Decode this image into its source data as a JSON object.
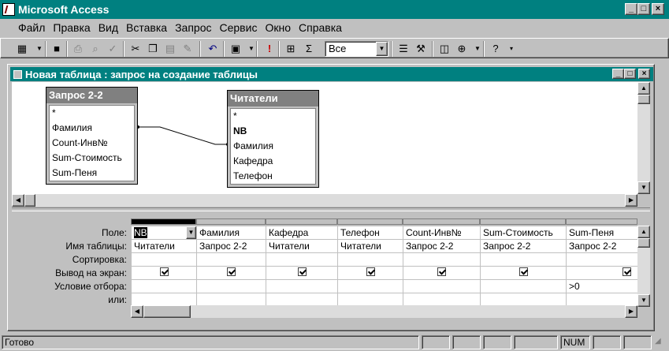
{
  "app": {
    "title": "Microsoft Access"
  },
  "menu": [
    "Файл",
    "Правка",
    "Вид",
    "Вставка",
    "Запрос",
    "Сервис",
    "Окно",
    "Справка"
  ],
  "toolbar": {
    "combo_value": "Все"
  },
  "child": {
    "title": "Новая таблица : запрос на создание таблицы"
  },
  "tables": [
    {
      "name": "Запрос 2-2",
      "fields": [
        "*",
        "Фамилия",
        "Count-Инв№",
        "Sum-Стоимость",
        "Sum-Пеня"
      ]
    },
    {
      "name": "Читатели",
      "fields": [
        "*",
        "NB",
        "Фамилия",
        "Кафедра",
        "Телефон"
      ]
    }
  ],
  "grid": {
    "row_labels": [
      "Поле:",
      "Имя таблицы:",
      "Сортировка:",
      "Вывод на экран:",
      "Условие отбора:",
      "или:"
    ],
    "columns": [
      {
        "field": "NB",
        "table": "Читатели",
        "criteria": ""
      },
      {
        "field": "Фамилия",
        "table": "Запрос 2-2",
        "criteria": ""
      },
      {
        "field": "Кафедра",
        "table": "Читатели",
        "criteria": ""
      },
      {
        "field": "Телефон",
        "table": "Читатели",
        "criteria": ""
      },
      {
        "field": "Count-Инв№",
        "table": "Запрос 2-2",
        "criteria": ""
      },
      {
        "field": "Sum-Стоимость",
        "table": "Запрос 2-2",
        "criteria": ""
      },
      {
        "field": "Sum-Пеня",
        "table": "Запрос 2-2",
        "criteria": ">0"
      }
    ]
  },
  "status": {
    "text": "Готово",
    "num": "NUM"
  }
}
